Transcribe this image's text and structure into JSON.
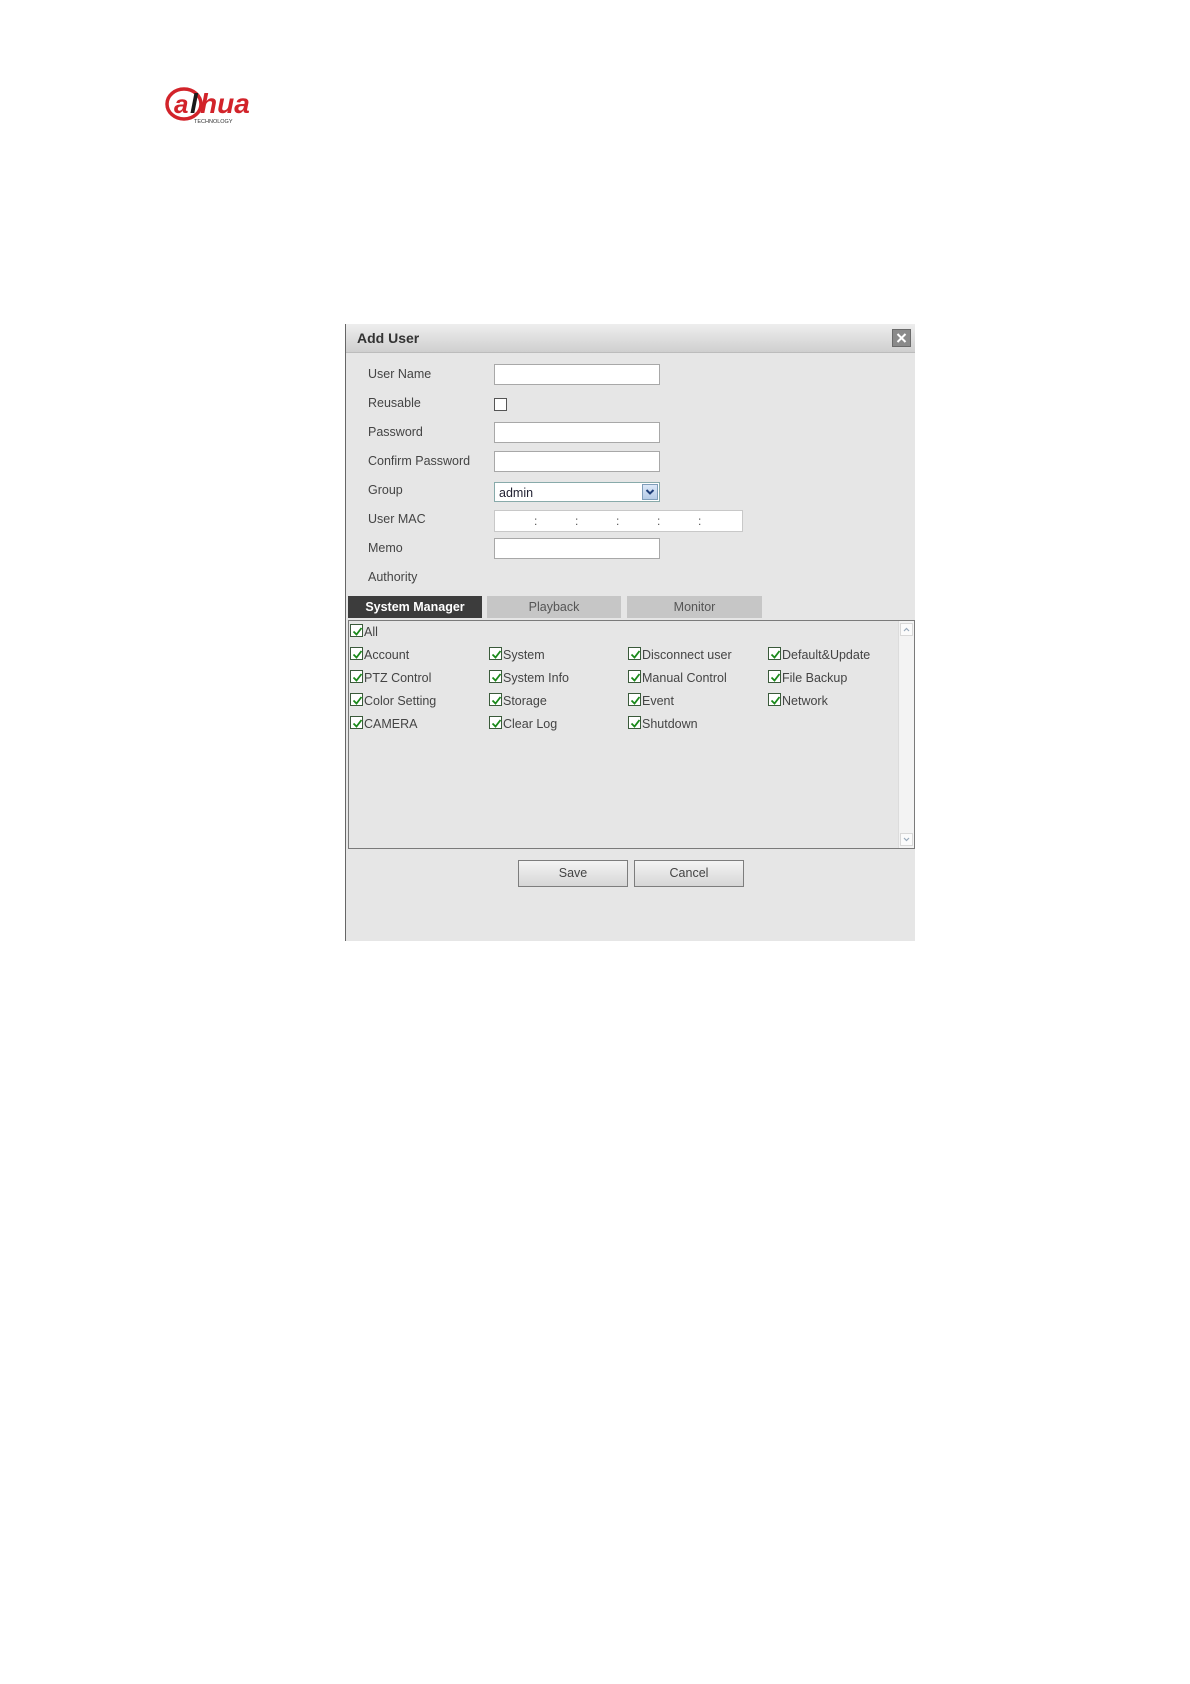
{
  "logo": {
    "wordmark": "alhua",
    "tagline": "TECHNOLOGY",
    "brand_color": "#d2232a"
  },
  "dialog": {
    "title": "Add User",
    "close_icon": "close-icon",
    "fields": {
      "user_name": {
        "label": "User Name",
        "value": ""
      },
      "reusable": {
        "label": "Reusable",
        "checked": false
      },
      "password": {
        "label": "Password",
        "value": ""
      },
      "confirm_password": {
        "label": "Confirm Password",
        "value": ""
      },
      "group": {
        "label": "Group",
        "value": "admin"
      },
      "user_mac": {
        "label": "User MAC",
        "separators": [
          ":",
          ":",
          ":",
          ":",
          ":"
        ]
      },
      "memo": {
        "label": "Memo",
        "value": ""
      },
      "authority": {
        "label": "Authority"
      }
    },
    "tabs": [
      {
        "label": "System Manager",
        "active": true
      },
      {
        "label": "Playback",
        "active": false
      },
      {
        "label": "Monitor",
        "active": false
      }
    ],
    "permissions": {
      "all": {
        "label": "All",
        "checked": true
      },
      "rows": [
        [
          {
            "label": "Account",
            "checked": true
          },
          {
            "label": "System",
            "checked": true
          },
          {
            "label": "Disconnect user",
            "checked": true
          },
          {
            "label": "Default&Update",
            "checked": true
          }
        ],
        [
          {
            "label": "PTZ Control",
            "checked": true
          },
          {
            "label": "System Info",
            "checked": true
          },
          {
            "label": "Manual Control",
            "checked": true
          },
          {
            "label": "File Backup",
            "checked": true
          }
        ],
        [
          {
            "label": "Color Setting",
            "checked": true
          },
          {
            "label": "Storage",
            "checked": true
          },
          {
            "label": "Event",
            "checked": true
          },
          {
            "label": "Network",
            "checked": true
          }
        ],
        [
          {
            "label": "CAMERA",
            "checked": true
          },
          {
            "label": "Clear Log",
            "checked": true
          },
          {
            "label": "Shutdown",
            "checked": true
          }
        ]
      ]
    },
    "buttons": {
      "save": "Save",
      "cancel": "Cancel"
    }
  }
}
